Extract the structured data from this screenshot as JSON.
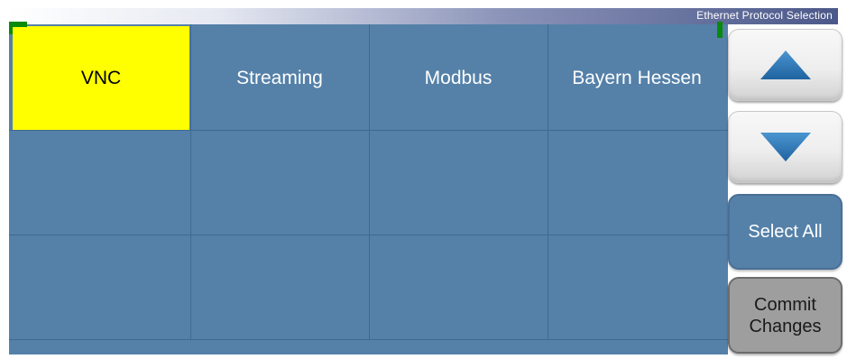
{
  "window": {
    "title": "Ethernet Protocol Selection"
  },
  "grid": {
    "cells": [
      {
        "label": "VNC",
        "selected": true
      },
      {
        "label": "Streaming",
        "selected": false
      },
      {
        "label": "Modbus",
        "selected": false
      },
      {
        "label": "Bayern Hessen",
        "selected": false
      },
      {
        "label": "",
        "selected": false
      },
      {
        "label": "",
        "selected": false
      },
      {
        "label": "",
        "selected": false
      },
      {
        "label": "",
        "selected": false
      },
      {
        "label": "",
        "selected": false
      },
      {
        "label": "",
        "selected": false
      },
      {
        "label": "",
        "selected": false
      },
      {
        "label": "",
        "selected": false
      }
    ]
  },
  "sidebar": {
    "up_icon": "triangle-up-icon",
    "down_icon": "triangle-down-icon",
    "select_all_label": "Select All",
    "commit_label_line1": "Commit",
    "commit_label_line2": "Changes"
  },
  "colors": {
    "cell_bg": "#5581a9",
    "selected_bg": "#ffff00",
    "arrow": "#2e79b5",
    "corner_marker": "#0a8a0a"
  }
}
